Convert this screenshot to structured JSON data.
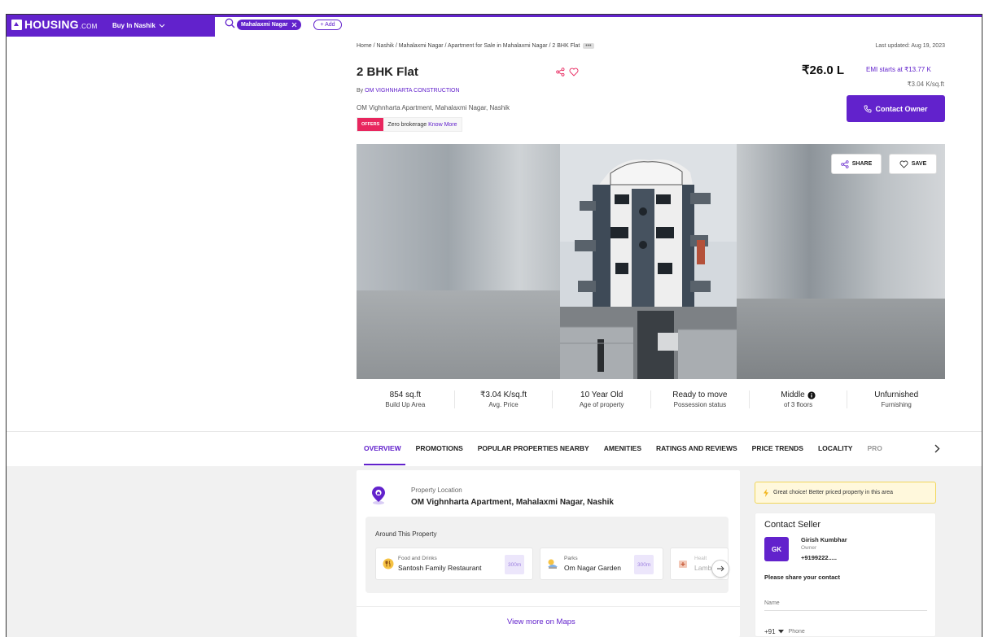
{
  "header": {
    "logo_text": "HOUSING",
    "logo_suffix": ".COM",
    "buy_in": "Buy In Nashik",
    "search_chip": "Mahalaxmi Nagar",
    "add_label": "+ Add",
    "brand_color": "#6222cc"
  },
  "breadcrumb": {
    "path": "Home / Nashik / Mahalaxmi Nagar / Apartment for Sale in Mahalaxmi Nagar / 2 BHK Flat",
    "more": "•••"
  },
  "last_updated": "Last updated: Aug 19, 2023",
  "listing": {
    "title": "2 BHK Flat",
    "by_prefix": "By ",
    "builder": "OM VIGHNHARTA CONSTRUCTION",
    "address": "OM Vighnharta Apartment, Mahalaxmi Nagar, Nashik",
    "price": "₹26.0 L",
    "emi": "EMI starts at ₹13.77 K",
    "price_per_sqft": "₹3.04 K/sq.ft",
    "contact_owner": "Contact Owner",
    "offer_badge": "OFFERS",
    "offer_text": "Zero brokerage",
    "offer_link": "Know More"
  },
  "gallery": {
    "share_label": "SHARE",
    "save_label": "SAVE"
  },
  "stats": [
    {
      "value": "854 sq.ft",
      "label": "Build Up Area"
    },
    {
      "value": "₹3.04 K/sq.ft",
      "label": "Avg. Price"
    },
    {
      "value": "10 Year Old",
      "label": "Age of property"
    },
    {
      "value": "Ready to move",
      "label": "Possession status"
    },
    {
      "value": "Middle",
      "label": "of 3 floors"
    },
    {
      "value": "Unfurnished",
      "label": "Furnishing"
    }
  ],
  "tabs": [
    "OVERVIEW",
    "PROMOTIONS",
    "POPULAR PROPERTIES NEARBY",
    "AMENITIES",
    "RATINGS AND REVIEWS",
    "PRICE TRENDS",
    "LOCALITY",
    "PRO"
  ],
  "location": {
    "label": "Property Location",
    "value": "OM Vighnharta Apartment, Mahalaxmi Nagar, Nashik",
    "around_title": "Around This Property",
    "places": [
      {
        "category": "Food and Drinks",
        "name": "Santosh Family Restaurant",
        "distance": "300m"
      },
      {
        "category": "Parks",
        "name": "Om Nagar Garden",
        "distance": "300m"
      },
      {
        "category": "Healt",
        "name": "Lamb"
      }
    ],
    "view_maps": "View more on Maps"
  },
  "contact": {
    "great_choice": "Great choice! Better priced property in this area",
    "title": "Contact Seller",
    "avatar": "GK",
    "seller_name": "Girish Kumbhar",
    "seller_role": "Owner",
    "seller_phone": "+9199222.....",
    "share_prompt": "Please share your contact",
    "name_placeholder": "Name",
    "country_code": "+91",
    "phone_placeholder": "Phone"
  }
}
